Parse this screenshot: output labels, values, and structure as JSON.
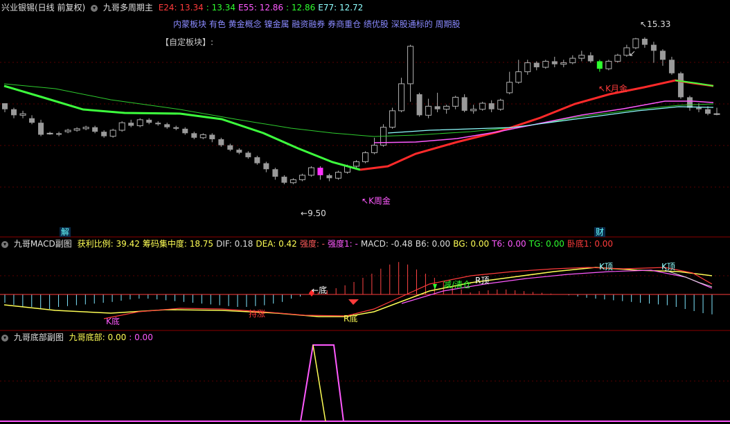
{
  "main": {
    "stock_name": "兴业银锡(日线 前复权)",
    "indicator_name": "九哥多周期主",
    "values": [
      {
        "label": "E24: 13.34",
        "color": "#ff3b3b"
      },
      {
        "label": ": 13.34",
        "color": "#2eff2e"
      },
      {
        "label": "E55: 12.86",
        "color": "#ff5aff"
      },
      {
        "label": ": 12.86",
        "color": "#2eff2e"
      },
      {
        "label": "E77: 12.72",
        "color": "#8fffff"
      }
    ],
    "concepts": "内蒙板块 有色 黄金概念 镍金属 融资融券 券商重仓 绩优股 深股通标的 周期股",
    "custom_block": "【自定板块】:",
    "high_label": "15.33",
    "low_label": "9.50",
    "annotations": {
      "k_week_gold": "K周金",
      "k_month_gold": "K月金"
    },
    "markers": {
      "jie": "解",
      "cai": "财"
    }
  },
  "macd": {
    "title": "九哥MACD副图",
    "items": [
      {
        "label": "获利比例: 39.42",
        "color": "#ffff55"
      },
      {
        "label": "筹码集中度: 18.75",
        "color": "#ffff55"
      },
      {
        "label": "DIF: 0.18",
        "color": "#dddddd"
      },
      {
        "label": "DEA: 0.42",
        "color": "#ffff55"
      },
      {
        "label": "强度: -",
        "color": "#ff5a5a"
      },
      {
        "label": "强度1: -",
        "color": "#ff5aff"
      },
      {
        "label": "MACD: -0.48",
        "color": "#dddddd"
      },
      {
        "label": "B6: 0.00",
        "color": "#dddddd"
      },
      {
        "label": "BG: 0.00",
        "color": "#ffff55"
      },
      {
        "label": "T6: 0.00",
        "color": "#ff5aff"
      },
      {
        "label": "TG: 0.00",
        "color": "#2eff2e"
      },
      {
        "label": "卧底1: 0.00",
        "color": "#ff3b3b"
      }
    ],
    "annotations": {
      "k_bottom": "K底",
      "hold": "持涨",
      "bottom": "底",
      "r_bottom": "R底",
      "reduce_clear": "减/清仓",
      "r_top": "R顶",
      "k_top1": "K顶",
      "k_top2": "K顶"
    }
  },
  "bottom": {
    "title": "九哥底部副图",
    "items": [
      {
        "label": "九哥底部: 0.00",
        "color": "#ffff55"
      },
      {
        "label": ": 0.00",
        "color": "#ff5aff"
      }
    ]
  },
  "chart_data": {
    "type": "candlestick",
    "title": "兴业银锡(日线 前复权)",
    "high": 15.33,
    "low": 9.5,
    "ylim": [
      9.2,
      15.9
    ],
    "series": [
      {
        "name": "E24",
        "color": "#ff3b3b",
        "last": 13.34
      },
      {
        "name": "E55",
        "color": "#ff5aff",
        "last": 12.86
      },
      {
        "name": "E77",
        "color": "#8fffff",
        "last": 12.72
      }
    ],
    "candles": [
      [
        13.15,
        12.95,
        13.05,
        12.85
      ],
      [
        12.95,
        12.75,
        13.0,
        12.65
      ],
      [
        12.75,
        12.8,
        12.9,
        12.65
      ],
      [
        12.65,
        12.5,
        12.75,
        12.45
      ],
      [
        12.5,
        12.1,
        12.6,
        12.05
      ],
      [
        12.15,
        12.15,
        12.2,
        12.1
      ],
      [
        12.15,
        12.1,
        12.2,
        12.05
      ],
      [
        12.2,
        12.25,
        12.3,
        12.15
      ],
      [
        12.25,
        12.3,
        12.35,
        12.2
      ],
      [
        12.3,
        12.35,
        12.4,
        12.25
      ],
      [
        12.35,
        12.2,
        12.4,
        12.15
      ],
      [
        12.2,
        12.05,
        12.25,
        12.0
      ],
      [
        12.05,
        12.25,
        12.3,
        12.0
      ],
      [
        12.25,
        12.5,
        12.55,
        12.2
      ],
      [
        12.5,
        12.4,
        12.6,
        12.35
      ],
      [
        12.4,
        12.6,
        12.65,
        12.35
      ],
      [
        12.6,
        12.5,
        12.65,
        12.45
      ],
      [
        12.5,
        12.45,
        12.55,
        12.4
      ],
      [
        12.45,
        12.35,
        12.5,
        12.3
      ],
      [
        12.35,
        12.3,
        12.4,
        12.25
      ],
      [
        12.3,
        12.15,
        12.35,
        12.1
      ],
      [
        12.15,
        12.0,
        12.2,
        11.95
      ],
      [
        12.0,
        12.1,
        12.15,
        11.95
      ],
      [
        12.1,
        11.95,
        12.15,
        11.85
      ],
      [
        11.95,
        11.75,
        12.0,
        11.7
      ],
      [
        11.75,
        11.6,
        11.8,
        11.55
      ],
      [
        11.6,
        11.5,
        11.65,
        11.45
      ],
      [
        11.5,
        11.35,
        11.55,
        11.3
      ],
      [
        11.35,
        11.15,
        11.4,
        11.1
      ],
      [
        11.15,
        10.95,
        11.2,
        10.85
      ],
      [
        10.95,
        10.7,
        11.0,
        10.6
      ],
      [
        10.7,
        10.5,
        10.75,
        10.45
      ],
      [
        10.5,
        10.6,
        10.65,
        10.45
      ],
      [
        10.6,
        10.75,
        10.8,
        10.55
      ],
      [
        10.75,
        11.0,
        11.05,
        10.7
      ],
      [
        11.0,
        10.75,
        11.05,
        10.6
      ],
      [
        10.75,
        10.65,
        10.8,
        10.55
      ],
      [
        10.65,
        10.85,
        10.9,
        10.6
      ],
      [
        10.85,
        11.05,
        11.1,
        10.8
      ],
      [
        11.05,
        11.2,
        11.25,
        11.0
      ],
      [
        11.2,
        11.5,
        11.55,
        11.15
      ],
      [
        11.5,
        11.75,
        12.0,
        11.45
      ],
      [
        11.75,
        12.35,
        12.45,
        11.7
      ],
      [
        12.35,
        12.9,
        13.0,
        12.3
      ],
      [
        12.9,
        13.8,
        14.0,
        12.85
      ],
      [
        13.8,
        15.05,
        15.1,
        13.2
      ],
      [
        13.45,
        12.75,
        13.5,
        12.7
      ],
      [
        12.75,
        13.05,
        13.3,
        12.65
      ],
      [
        13.05,
        12.95,
        13.5,
        12.85
      ],
      [
        12.95,
        13.05,
        13.1,
        12.8
      ],
      [
        13.05,
        13.35,
        13.4,
        12.95
      ],
      [
        13.35,
        12.9,
        13.45,
        12.85
      ],
      [
        12.9,
        12.95,
        13.1,
        12.8
      ],
      [
        12.95,
        13.15,
        13.2,
        12.9
      ],
      [
        13.15,
        12.95,
        13.25,
        12.85
      ],
      [
        12.95,
        13.25,
        13.3,
        12.9
      ],
      [
        13.5,
        13.85,
        14.2,
        13.45
      ],
      [
        13.85,
        14.2,
        14.6,
        13.8
      ],
      [
        14.2,
        14.5,
        14.6,
        14.1
      ],
      [
        14.5,
        14.35,
        14.55,
        14.25
      ],
      [
        14.35,
        14.55,
        14.6,
        14.3
      ],
      [
        14.55,
        14.45,
        14.7,
        14.35
      ],
      [
        14.45,
        14.5,
        14.6,
        14.35
      ],
      [
        14.5,
        14.65,
        14.75,
        14.45
      ],
      [
        14.65,
        14.75,
        14.9,
        14.55
      ],
      [
        14.75,
        14.55,
        14.85,
        14.5
      ],
      [
        14.55,
        14.3,
        14.6,
        14.2
      ],
      [
        14.3,
        14.55,
        14.6,
        14.25
      ],
      [
        14.55,
        14.75,
        14.8,
        14.5
      ],
      [
        14.75,
        15.0,
        15.1,
        14.7
      ],
      [
        15.0,
        15.3,
        15.33,
        14.95
      ],
      [
        15.3,
        15.1,
        15.35,
        15.0
      ],
      [
        15.1,
        14.9,
        15.2,
        14.5
      ],
      [
        14.9,
        14.6,
        14.95,
        14.4
      ],
      [
        14.6,
        14.15,
        14.7,
        14.1
      ],
      [
        14.15,
        13.35,
        14.2,
        13.3
      ],
      [
        13.35,
        13.0,
        13.4,
        12.9
      ],
      [
        13.0,
        12.95,
        13.15,
        12.85
      ],
      [
        12.95,
        12.8,
        13.05,
        12.75
      ],
      [
        12.8,
        12.8,
        13.0,
        12.75
      ]
    ],
    "macd_hist": [
      -0.2,
      -0.25,
      -0.3,
      -0.3,
      -0.35,
      -0.35,
      -0.3,
      -0.28,
      -0.26,
      -0.24,
      -0.22,
      -0.2,
      -0.18,
      -0.15,
      -0.12,
      -0.1,
      -0.1,
      -0.12,
      -0.14,
      -0.16,
      -0.18,
      -0.2,
      -0.22,
      -0.24,
      -0.26,
      -0.28,
      -0.3,
      -0.3,
      -0.28,
      -0.26,
      -0.22,
      -0.18,
      -0.1,
      -0.05,
      0.02,
      0.06,
      0.1,
      0.15,
      0.22,
      0.3,
      0.4,
      0.5,
      0.62,
      0.72,
      0.78,
      0.72,
      0.6,
      0.5,
      0.4,
      0.3,
      0.2,
      0.12,
      0.05,
      0.08,
      0.1,
      0.12,
      0.12,
      0.1,
      0.08,
      0.06,
      0.04,
      0.02,
      0.0,
      -0.02,
      -0.05,
      -0.08,
      -0.1,
      -0.12,
      -0.14,
      -0.16,
      -0.18,
      -0.2,
      -0.22,
      -0.24,
      -0.26,
      -0.3,
      -0.35,
      -0.4,
      -0.45,
      -0.48
    ]
  }
}
